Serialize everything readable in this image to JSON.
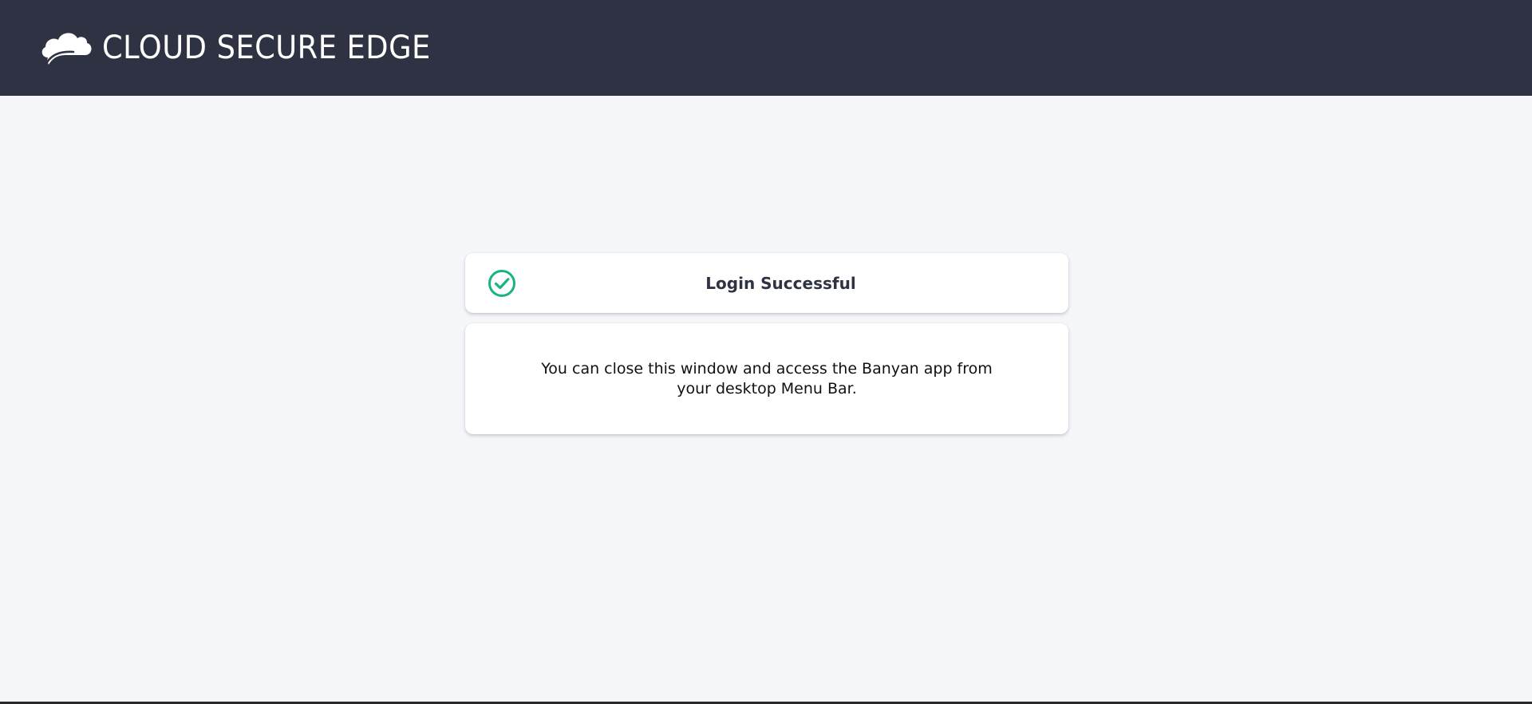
{
  "header": {
    "logo_icon": "cloud-logo-icon",
    "brand_name": "CLOUD SECURE EDGE"
  },
  "status": {
    "icon": "check-circle-icon",
    "title": "Login Successful"
  },
  "message": {
    "text": "You can close this window and access the Banyan app from your desktop Menu Bar."
  },
  "colors": {
    "header_bg": "#2f3242",
    "page_bg": "#f4f6fa",
    "success_green": "#18b47e"
  }
}
